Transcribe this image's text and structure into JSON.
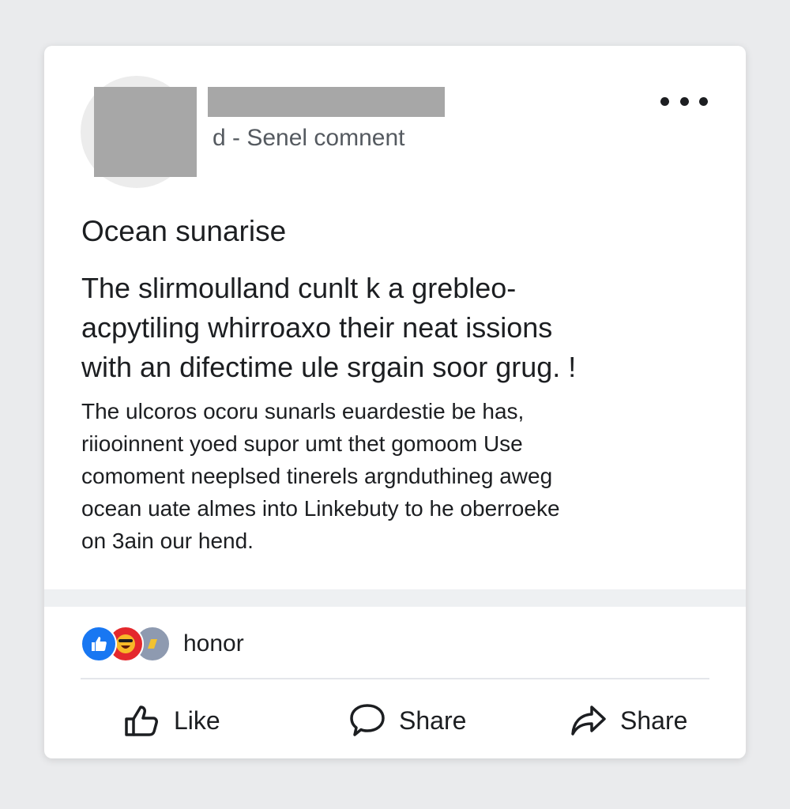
{
  "post": {
    "subtitle": "d - Senel comnent",
    "title": "Ocean sunarise",
    "lead_lines": [
      "The slirmoulland cunlt k a grebleo-",
      "acpytiling whirroaxo their neat issions",
      "with an difectime ule srgain soor grug. !"
    ],
    "body_lines": [
      "The ulcoros ocoru sunarls euardestie be has,",
      "riiooinnent yoed supor umt thet gomoom Use",
      "comoment neeplsed tinerels argnduthineg aweg",
      "ocean uate almes into Linkebuty to he oberroeke",
      "on 3ain our hend."
    ]
  },
  "reactions": {
    "count_label": "honor",
    "icons": [
      "like-icon",
      "haha-icon",
      "wow-icon"
    ],
    "colors": {
      "like": "#1877f2",
      "haha": "#e4282d",
      "wow": "#8e9ab0"
    }
  },
  "actions": {
    "like_label": "Like",
    "comment_label": "Share",
    "share_label": "Share"
  }
}
